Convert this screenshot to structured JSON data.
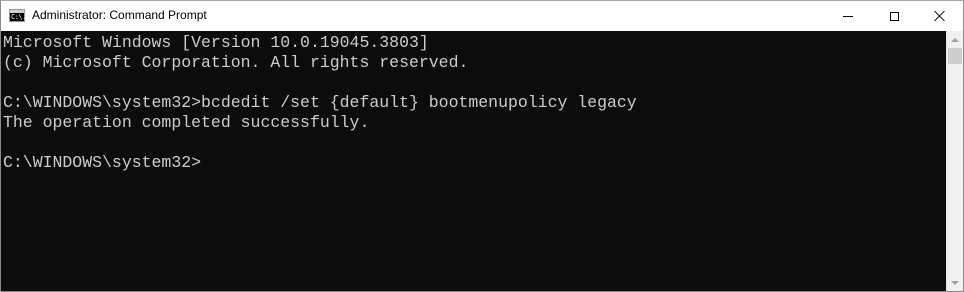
{
  "window": {
    "title": "Administrator: Command Prompt",
    "icon": "cmd-app-icon",
    "icon_glyph": "C:\\."
  },
  "controls": {
    "minimize_icon": "minimize-icon",
    "maximize_icon": "maximize-icon",
    "close_icon": "close-icon"
  },
  "console": {
    "lines": [
      "Microsoft Windows [Version 10.0.19045.3803]",
      "(c) Microsoft Corporation. All rights reserved.",
      "C:\\WINDOWS\\system32>bcdedit /set {default} bootmenupolicy legacy",
      "The operation completed successfully.",
      "C:\\WINDOWS\\system32>"
    ],
    "background": "#0c0c0c",
    "foreground": "#cccccc"
  }
}
